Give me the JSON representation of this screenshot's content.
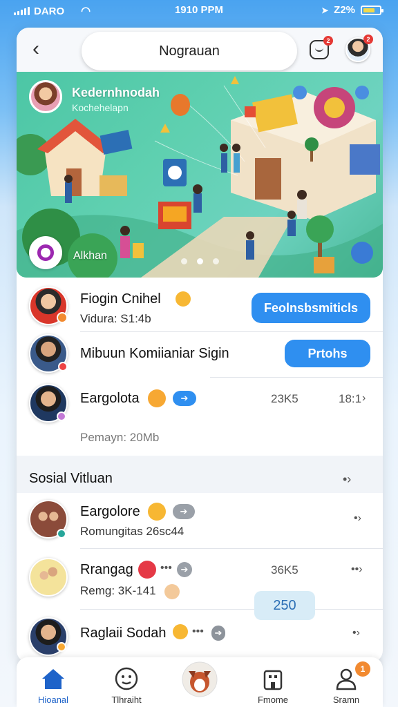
{
  "status_bar": {
    "carrier": "DARO",
    "time": "1910 PPM",
    "battery": "Z2%"
  },
  "header": {
    "title": "Nograuan",
    "notification_badge": "2",
    "avatar_badge": "2"
  },
  "hero": {
    "title": "Kedernhnodah",
    "subtitle": "Kochehelapn",
    "caption": "Alkhan",
    "slides": 3,
    "active_slide": 2
  },
  "rows": [
    {
      "title": "Fiogin Cnihel",
      "subtitle": "Vidura: S1:4b",
      "button": "Feolnsbsmiticls"
    },
    {
      "title": "Mibuun Komiianiar Sigin",
      "button": "Prtohs"
    },
    {
      "title": "Eargolota",
      "count": "23K5",
      "meta": "18:1",
      "subtitle": "Pemayn: 20Mb"
    }
  ],
  "section": {
    "title": "Sosial Vitluan",
    "more": "→"
  },
  "section_rows": [
    {
      "title": "Eargolore",
      "subtitle": "Romungitas 26sc44"
    },
    {
      "title": "Rrangag",
      "count": "36K5",
      "subtitle": "Remg: 3K-141"
    },
    {
      "title": "Raglaii Sodah",
      "count": "250"
    }
  ],
  "nav": [
    {
      "label": "Hioanal",
      "icon": "home-icon",
      "active": true
    },
    {
      "label": "Tlhraiht",
      "icon": "face-icon",
      "active": false
    },
    {
      "label": "",
      "icon": "center-avatar-icon",
      "active": false
    },
    {
      "label": "Fmome",
      "icon": "building-icon",
      "active": false
    },
    {
      "label": "Sramn",
      "icon": "profile-icon",
      "active": false,
      "badge": "1"
    }
  ],
  "colors": {
    "accent": "#2f8ff0",
    "hero_bg": "#4cc6a5",
    "nav_active": "#1e63c9"
  }
}
